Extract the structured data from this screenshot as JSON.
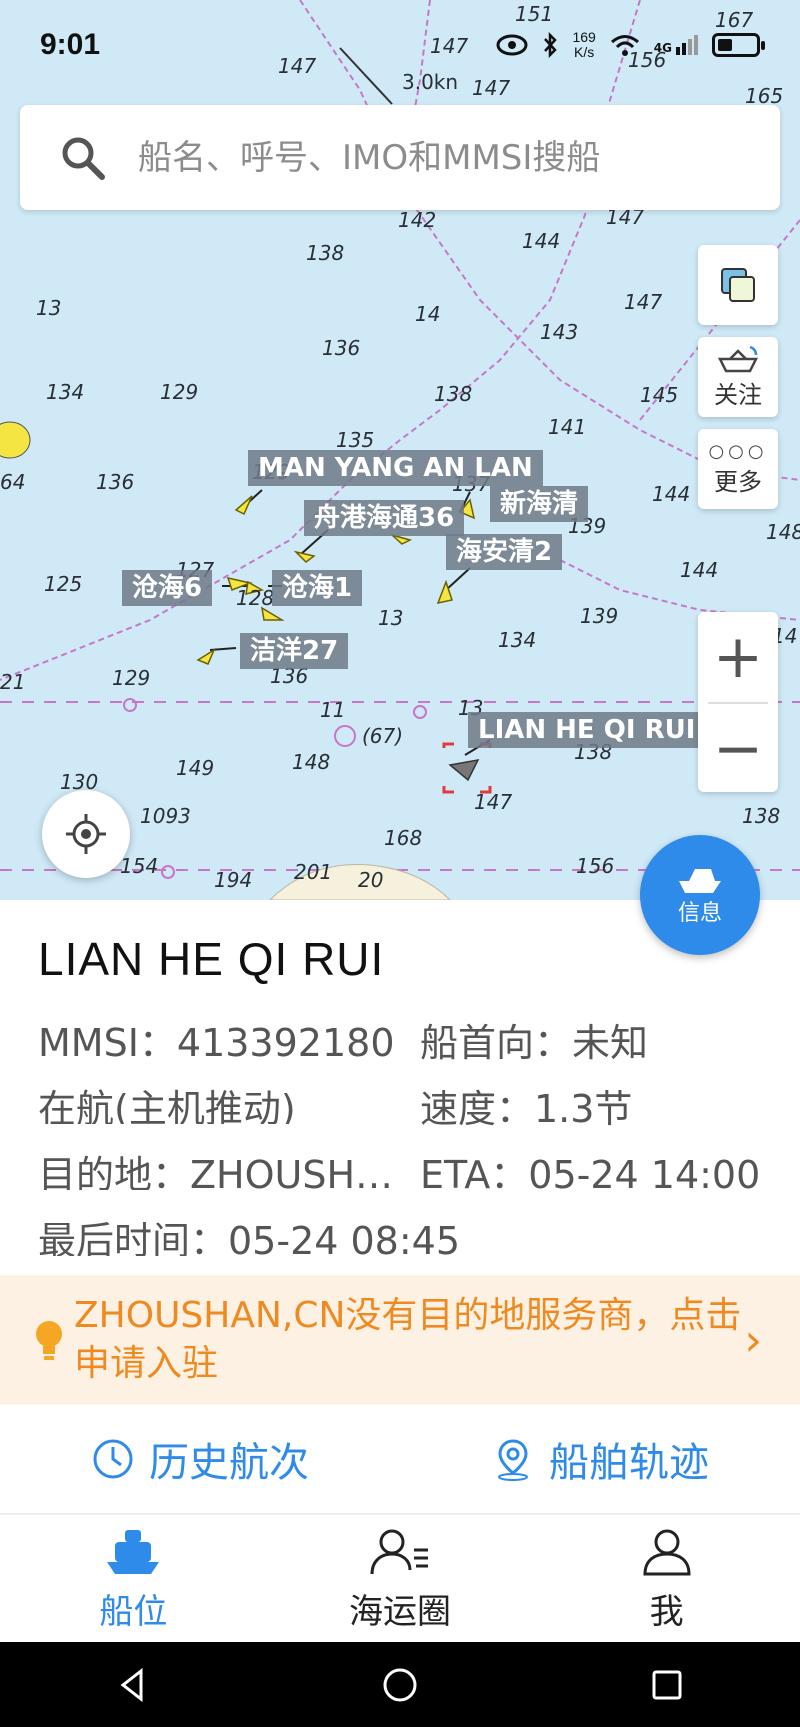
{
  "status_bar": {
    "time": "9:01",
    "net_speed_value": "169",
    "net_speed_unit": "K/s",
    "network": "4G"
  },
  "search": {
    "placeholder": "船名、呼号、IMO和MMSI搜船"
  },
  "map_tools": {
    "layers_icon": "layers-icon",
    "follow_label": "关注",
    "more_label": "更多",
    "zoom_in": "+",
    "zoom_out": "−",
    "info_label": "信息"
  },
  "map": {
    "current_label": "3.0kn",
    "depths": [
      {
        "v": "151"
      },
      {
        "v": "167"
      },
      {
        "v": "147"
      },
      {
        "v": "147"
      },
      {
        "v": "147"
      },
      {
        "v": "165"
      },
      {
        "v": "156"
      },
      {
        "v": "142"
      },
      {
        "v": "147"
      },
      {
        "v": "138"
      },
      {
        "v": "144"
      },
      {
        "v": "13"
      },
      {
        "v": "14"
      },
      {
        "v": "147"
      },
      {
        "v": "136"
      },
      {
        "v": "143"
      },
      {
        "v": "134"
      },
      {
        "v": "129"
      },
      {
        "v": "138"
      },
      {
        "v": "145"
      },
      {
        "v": "141"
      },
      {
        "v": "135"
      },
      {
        "v": "64"
      },
      {
        "v": "136"
      },
      {
        "v": "129"
      },
      {
        "v": "137"
      },
      {
        "v": "139"
      },
      {
        "v": "144"
      },
      {
        "v": "148"
      },
      {
        "v": "125"
      },
      {
        "v": "127"
      },
      {
        "v": "128"
      },
      {
        "v": "13"
      },
      {
        "v": "144"
      },
      {
        "v": "139"
      },
      {
        "v": "134"
      },
      {
        "v": "129"
      },
      {
        "v": "136"
      },
      {
        "v": "11"
      },
      {
        "v": "13"
      },
      {
        "v": "14"
      },
      {
        "v": "148"
      },
      {
        "v": "149"
      },
      {
        "v": "138"
      },
      {
        "v": "130"
      },
      {
        "v": "147"
      },
      {
        "v": "138"
      },
      {
        "v": "1093"
      },
      {
        "v": "168"
      },
      {
        "v": "154"
      },
      {
        "v": "194"
      },
      {
        "v": "201"
      },
      {
        "v": "20"
      },
      {
        "v": "156"
      },
      {
        "v": "(67)"
      },
      {
        "v": "21"
      }
    ],
    "vessels": [
      {
        "name": "MAN YANG AN LAN"
      },
      {
        "name": "新海清"
      },
      {
        "name": "舟港海通36"
      },
      {
        "name": "海安清2"
      },
      {
        "name": "沧海6"
      },
      {
        "name": "沧海1"
      },
      {
        "name": "洁洋27"
      },
      {
        "name": "LIAN HE QI RUI"
      }
    ]
  },
  "vessel": {
    "name": "LIAN HE QI RUI",
    "mmsi": "MMSI：413392180",
    "heading": "船首向：未知",
    "nav_status": "在航(主机推动)",
    "speed": "速度：1.3节",
    "destination": "目的地：ZHOUSH…",
    "eta": "ETA：05-24 14:00",
    "last_time": "最后时间：05-24 08:45"
  },
  "banner": {
    "text": "ZHOUSHAN,CN没有目的地服务商，点击申请入驻",
    "chevron": "›"
  },
  "actions": {
    "history": "历史航次",
    "track": "船舶轨迹"
  },
  "tabs": [
    {
      "label": "船位"
    },
    {
      "label": "海运圈"
    },
    {
      "label": "我"
    }
  ],
  "colors": {
    "accent": "#2f8bea",
    "banner_text": "#ee8a1f",
    "map_water": "#cfe9f7"
  }
}
